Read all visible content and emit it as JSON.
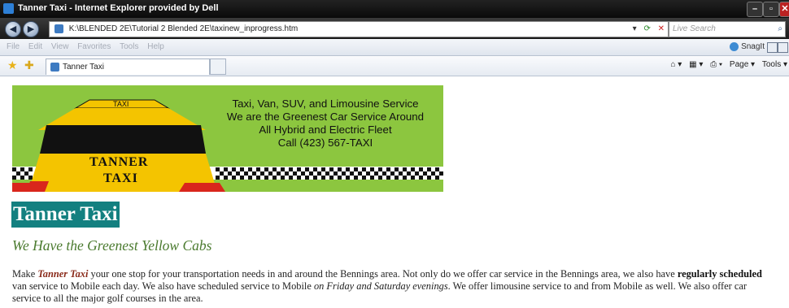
{
  "window": {
    "title": "Tanner Taxi - Internet Explorer provided by Dell",
    "buttons": [
      "–",
      "▫",
      "✕"
    ]
  },
  "address_bar": {
    "url": "K:\\BLENDED 2E\\Tutorial 2 Blended 2E\\taxinew_inprogress.htm",
    "search_placeholder": "Live Search"
  },
  "menu": {
    "items": [
      "File",
      "Edit",
      "View",
      "Favorites",
      "Tools",
      "Help"
    ],
    "snagit_label": "SnagIt"
  },
  "favorites_bar": {
    "tab_title": "Tanner Taxi",
    "commands": [
      "Page ▾",
      "Tools ▾"
    ]
  },
  "banner": {
    "roof_sign": "TAXI",
    "door_line1": "TANNER",
    "door_line2": "TAXI",
    "lines": [
      "Taxi, Van, SUV, and Limousine Service",
      "We are the Greenest Car Service Around",
      "All Hybrid and Electric Fleet",
      "Call (423) 567-TAXI"
    ]
  },
  "page": {
    "heading": "Tanner Taxi",
    "subheading": "We Have the Greenest Yellow Cabs",
    "paragraph": {
      "l1_a": "Make ",
      "l1_em": "Tanner Taxi",
      "l1_b": " your one stop for your transportation needs in and around the Bennings area. Not only do we offer car service in the Bennings area, we also have ",
      "l1_bold": "regularly scheduled",
      "l2_a": "van service to Mobile each day. We also have scheduled service to Mobile ",
      "l2_it": "on Friday and Saturday evenings",
      "l2_b": ". We offer limousine service to and from Mobile as well. We also offer car",
      "l3": "service to all the major golf courses in the area."
    }
  }
}
